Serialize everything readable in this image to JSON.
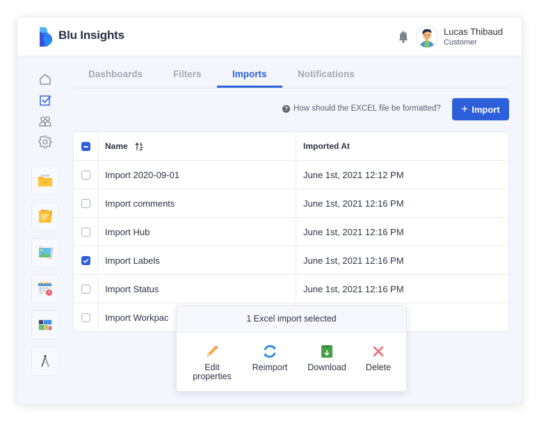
{
  "app": {
    "brand": "Blu Insights",
    "colors": {
      "accent": "#2c5fd9",
      "background": "#f3f6fd",
      "text": "#2d3446",
      "muted_tab": "#a4aab8"
    }
  },
  "header": {
    "notification_icon": "bell-icon",
    "user": {
      "name": "Lucas Thibaud",
      "role": "Customer",
      "avatar": "user-avatar"
    }
  },
  "sidebar": {
    "nav": [
      {
        "icon": "home-icon",
        "label": "Home",
        "active": false
      },
      {
        "icon": "checkbox-icon",
        "label": "Tasks",
        "active": true
      },
      {
        "icon": "users-icon",
        "label": "Users",
        "active": false
      },
      {
        "icon": "gear-icon",
        "label": "Settings",
        "active": false
      }
    ],
    "apps": [
      {
        "icon": "folder-icon"
      },
      {
        "icon": "notes-icon"
      },
      {
        "icon": "image-icon"
      },
      {
        "icon": "calendar-icon"
      },
      {
        "icon": "dashboard-icon"
      },
      {
        "icon": "compass-icon"
      }
    ]
  },
  "tabs": [
    {
      "label": "Dashboards",
      "active": false
    },
    {
      "label": "Filters",
      "active": false
    },
    {
      "label": "Imports",
      "active": true
    },
    {
      "label": "Notifications",
      "active": false
    }
  ],
  "toolbar": {
    "help_text": "How should the EXCEL file be formatted?",
    "help_icon_glyph": "?",
    "import_button": "Import",
    "import_plus": "+"
  },
  "table": {
    "columns": {
      "name": "Name",
      "imported_at": "Imported At"
    },
    "select_all_state": "indeterminate",
    "rows": [
      {
        "name": "Import 2020-09-01",
        "imported_at": "June 1st, 2021 12:12 PM",
        "checked": false
      },
      {
        "name": "Import comments",
        "imported_at": "June 1st, 2021 12:16 PM",
        "checked": false
      },
      {
        "name": "Import Hub",
        "imported_at": "June 1st, 2021 12:16 PM",
        "checked": false
      },
      {
        "name": "Import Labels",
        "imported_at": "June 1st, 2021 12:16 PM",
        "checked": true
      },
      {
        "name": "Import Status",
        "imported_at": "June 1st, 2021 12:16 PM",
        "checked": false
      },
      {
        "name": "Import Workpac",
        "imported_at": "",
        "checked": false
      }
    ]
  },
  "selection_popup": {
    "title": "1 Excel import selected",
    "actions": [
      {
        "label_line1": "Edit",
        "label_line2": "properties",
        "icon": "pencil-icon"
      },
      {
        "label_line1": "Reimport",
        "label_line2": "",
        "icon": "refresh-icon"
      },
      {
        "label_line1": "Download",
        "label_line2": "",
        "icon": "download-icon"
      },
      {
        "label_line1": "Delete",
        "label_line2": "",
        "icon": "close-icon"
      }
    ]
  }
}
